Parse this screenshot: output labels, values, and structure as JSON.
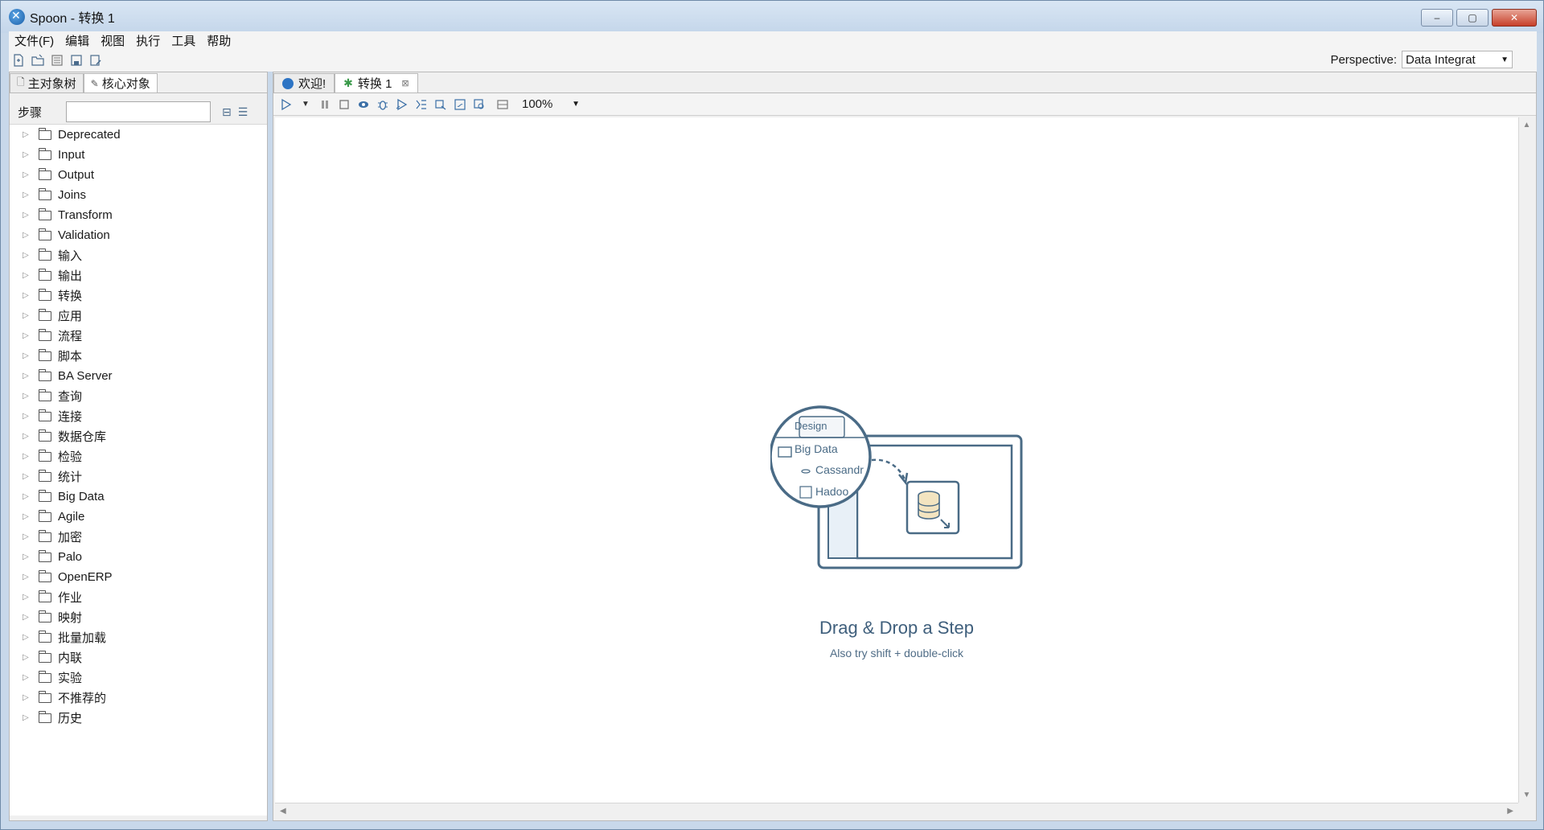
{
  "window": {
    "title": "Spoon - 转换 1",
    "controls": [
      "–",
      "▢",
      "✕"
    ]
  },
  "menubar": {
    "items": [
      "文件(F)",
      "编辑",
      "视图",
      "执行",
      "工具",
      "帮助"
    ]
  },
  "perspective": {
    "label": "Perspective:",
    "value": "Data Integrat"
  },
  "left_panel": {
    "tabs": [
      {
        "label": "主对象树"
      },
      {
        "label": "核心对象"
      }
    ],
    "steps_label": "步骤",
    "search_value": "",
    "tree": [
      "Deprecated",
      "Input",
      "Output",
      "Joins",
      "Transform",
      "Validation",
      "输入",
      "输出",
      "转换",
      "应用",
      "流程",
      "脚本",
      "BA Server",
      "查询",
      "连接",
      "数据仓库",
      "检验",
      "统计",
      "Big Data",
      "Agile",
      "加密",
      "Palo",
      "OpenERP",
      "作业",
      "映射",
      "批量加载",
      "内联",
      "实验",
      "不推荐的",
      "历史"
    ]
  },
  "doc_tabs": [
    {
      "label": "欢迎!",
      "icon": "spoon-icon"
    },
    {
      "label": "转换 1",
      "icon": "transformation-icon",
      "closable": true
    }
  ],
  "canvas_toolbar": {
    "zoom": "100%"
  },
  "canvas": {
    "illustration": {
      "tab_label": "Design",
      "folder_label": "Big Data",
      "item1": "Cassandr",
      "item2": "Hadoo"
    },
    "title": "Drag & Drop a Step",
    "subtitle": "Also try shift + double-click"
  }
}
